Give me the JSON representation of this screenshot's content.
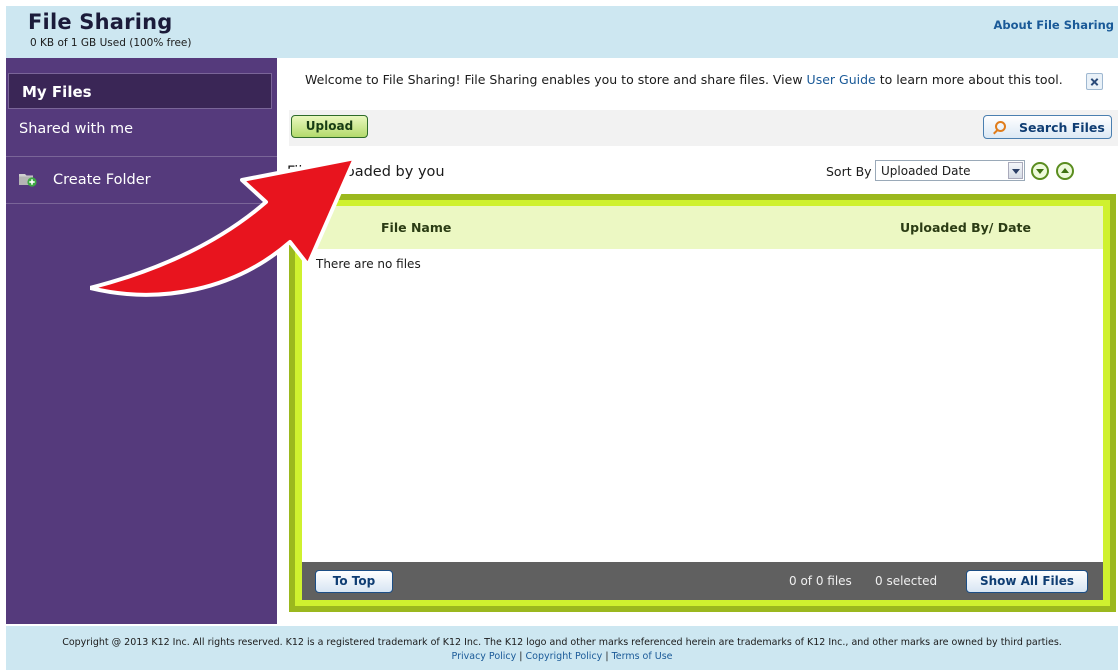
{
  "header": {
    "title": "File Sharing",
    "quota": "0 KB of 1 GB Used (100% free)",
    "about_link": "About File Sharing"
  },
  "sidebar": {
    "items": [
      {
        "label": "My Files",
        "active": true
      },
      {
        "label": "Shared with me",
        "active": false
      },
      {
        "label": "Create Folder",
        "icon": "folder-add-icon"
      }
    ]
  },
  "main": {
    "welcome": {
      "text_before": "Welcome to File Sharing! File Sharing enables you to store and share files. View ",
      "link": "User Guide",
      "text_after": " to learn more about this tool."
    },
    "upload_label": "Upload",
    "search_label": "Search Files",
    "section_title": "Files uploaded by you",
    "sort_label": "Sort By",
    "sort_value": "Uploaded Date",
    "table": {
      "columns": [
        "File Name",
        "Uploaded By/ Date"
      ],
      "empty_message": "There are no files"
    },
    "footer_bar": {
      "to_top_label": "To Top",
      "count_text": "0 of 0 files",
      "selected_text": "0 selected",
      "show_all_label": "Show All Files"
    }
  },
  "footer": {
    "copyright": "Copyright @ 2013 K12 Inc. All rights reserved. K12 is a registered trademark of K12 Inc. The K12 logo and other marks referenced herein are trademarks of K12 Inc., and other marks are owned by third parties.",
    "links": [
      "Privacy Policy",
      "Copyright Policy",
      "Terms of Use"
    ]
  },
  "colors": {
    "sidebar": "#553a7c",
    "header": "#cde7f1",
    "panel_border": "#cff12f",
    "arrow": "#e8141e"
  }
}
